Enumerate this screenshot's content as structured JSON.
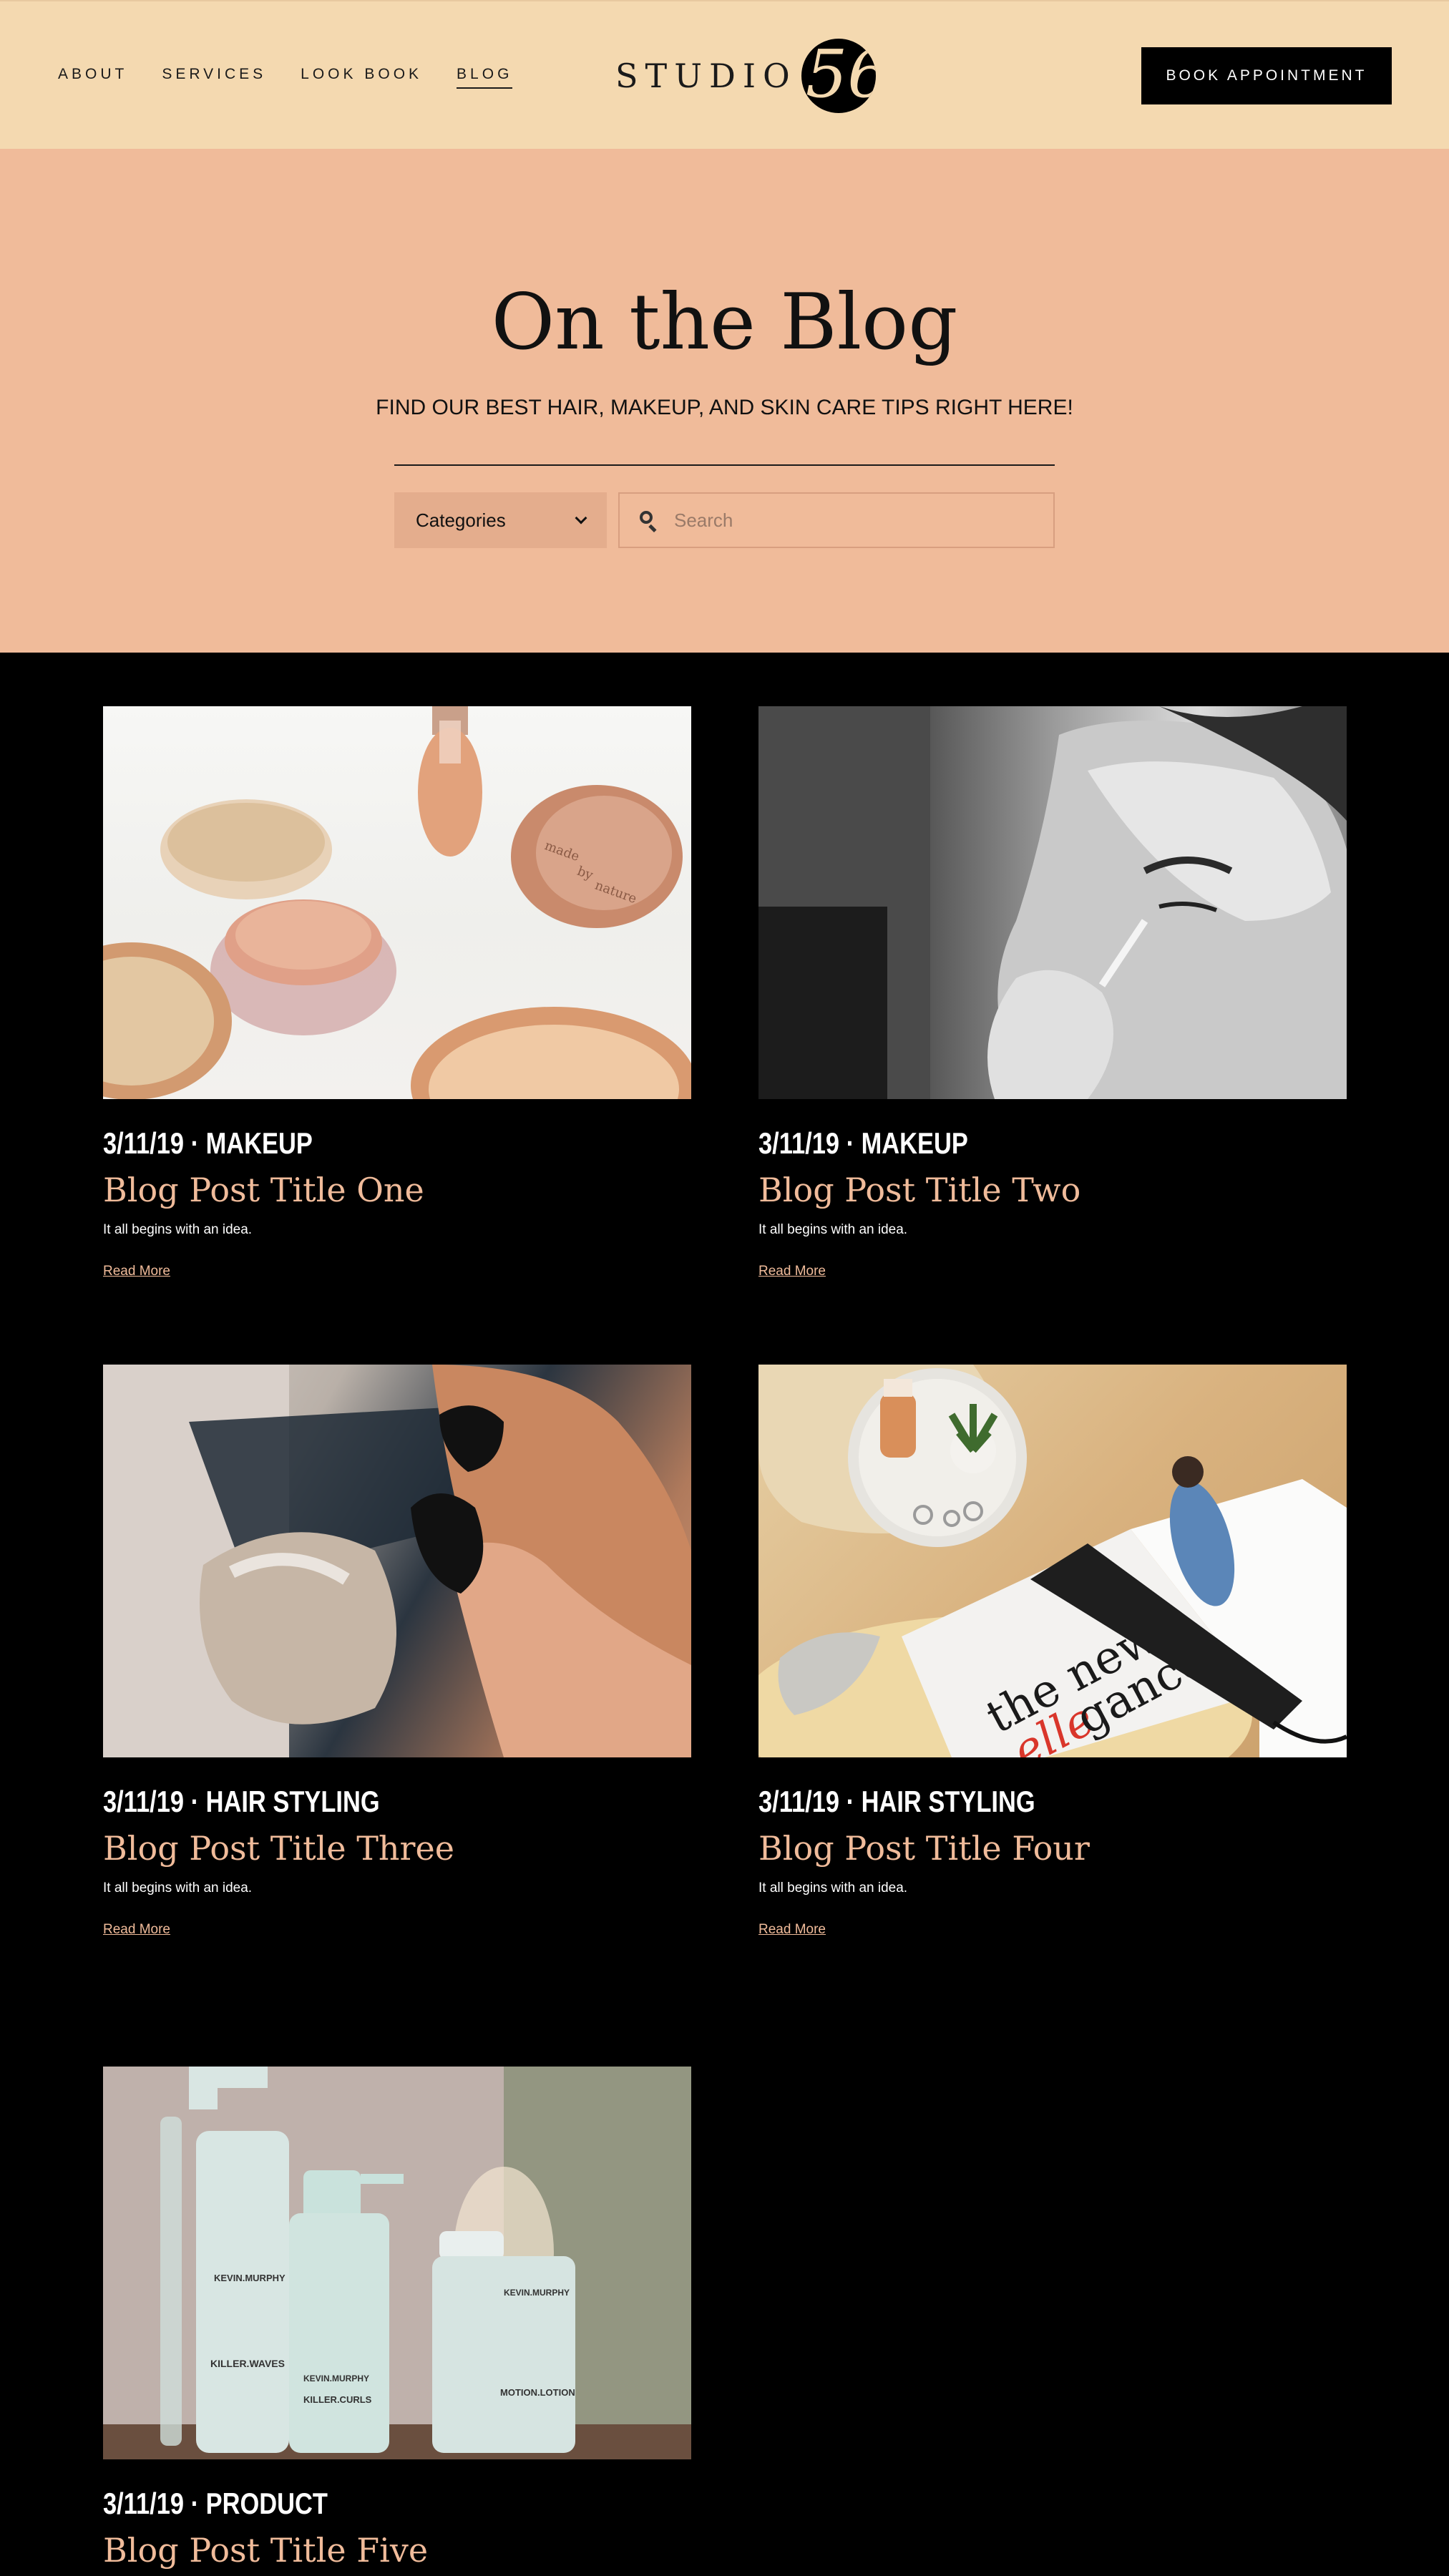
{
  "header": {
    "nav": [
      {
        "label": "ABOUT",
        "active": false
      },
      {
        "label": "SERVICES",
        "active": false
      },
      {
        "label": "LOOK BOOK",
        "active": false
      },
      {
        "label": "BLOG",
        "active": true
      }
    ],
    "logo": {
      "text": "STUDIO",
      "badge": "56"
    },
    "book_button": "BOOK APPOINTMENT"
  },
  "hero": {
    "title": "On the Blog",
    "subtitle": "FIND OUR BEST HAIR, MAKEUP, AND SKIN CARE TIPS RIGHT HERE!",
    "categories_label": "Categories",
    "search_placeholder": "Search"
  },
  "posts": [
    {
      "meta": "3/11/19 · MAKEUP",
      "title": "Blog Post Title One",
      "excerpt": "It all begins with an idea.",
      "read_more": "Read More"
    },
    {
      "meta": "3/11/19 · MAKEUP",
      "title": "Blog Post Title Two",
      "excerpt": "It all begins with an idea.",
      "read_more": "Read More"
    },
    {
      "meta": "3/11/19 · HAIR STYLING",
      "title": "Blog Post Title Three",
      "excerpt": "It all begins with an idea.",
      "read_more": "Read More"
    },
    {
      "meta": "3/11/19 · HAIR STYLING",
      "title": "Blog Post Title Four",
      "excerpt": "It all begins with an idea.",
      "read_more": "Read More"
    },
    {
      "meta": "3/11/19 · PRODUCT",
      "title": "Blog Post Title Five"
    }
  ],
  "images": {
    "post1": {
      "caption_words": [
        "made",
        "by",
        "nature"
      ]
    },
    "post4": {
      "magazine_words": [
        "the new",
        "elle",
        "gance"
      ]
    },
    "post5": {
      "brand": "KEVIN.MURPHY",
      "products": [
        "KILLER.WAVES",
        "KILLER.CURLS",
        "MOTION.LOTION"
      ]
    }
  },
  "colors": {
    "header_bg": "#f4d9b0",
    "hero_bg": "#f0bb9a",
    "body_bg": "#000000",
    "accent": "#f0bb9a"
  }
}
